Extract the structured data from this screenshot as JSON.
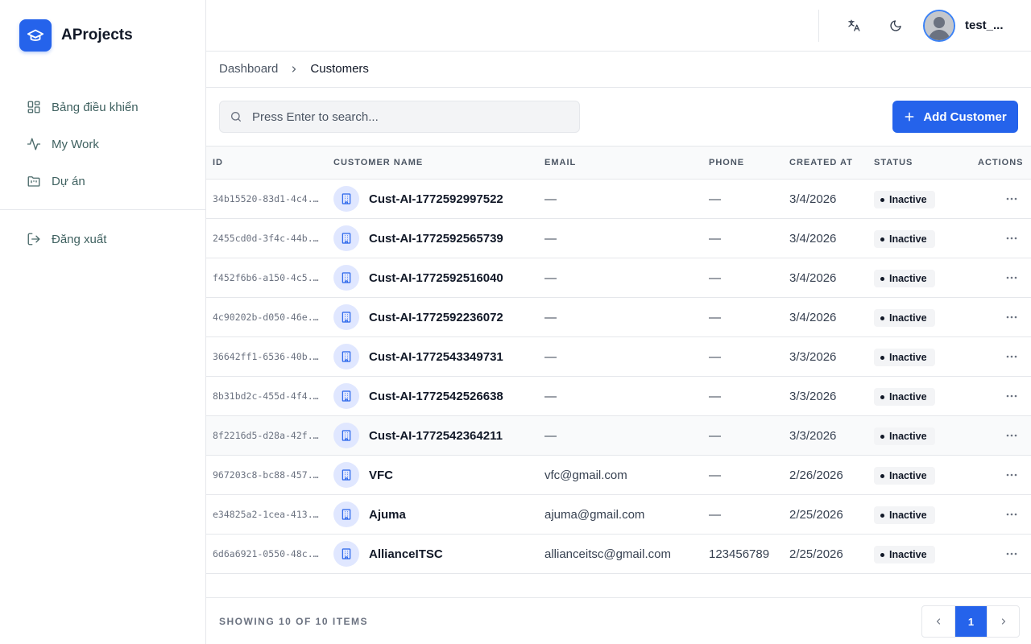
{
  "app": {
    "name": "AProjects"
  },
  "sidebar": {
    "items": [
      {
        "label": "Bảng điều khiển",
        "icon": "dashboard-grid-icon"
      },
      {
        "label": "My Work",
        "icon": "activity-icon"
      },
      {
        "label": "Dự án",
        "icon": "folder-kanban-icon"
      }
    ],
    "logout": {
      "label": "Đăng xuất",
      "icon": "logout-icon"
    }
  },
  "header": {
    "user": {
      "name": "test_..."
    },
    "icons": [
      "translate-icon",
      "moon-icon"
    ]
  },
  "breadcrumb": {
    "parent": "Dashboard",
    "current": "Customers"
  },
  "toolbar": {
    "search_placeholder": "Press Enter to search...",
    "add_label": "Add Customer"
  },
  "table": {
    "columns": {
      "id": "ID",
      "name": "Customer Name",
      "email": "Email",
      "phone": "Phone",
      "created": "Created At",
      "status": "Status",
      "actions": "Actions"
    },
    "rows": [
      {
        "id": "34b15520-83d1-4c4...",
        "name": "Cust-AI-1772592997522",
        "email": "—",
        "phone": "—",
        "created": "3/4/2026",
        "status": "Inactive"
      },
      {
        "id": "2455cd0d-3f4c-44b...",
        "name": "Cust-AI-1772592565739",
        "email": "—",
        "phone": "—",
        "created": "3/4/2026",
        "status": "Inactive"
      },
      {
        "id": "f452f6b6-a150-4c5...",
        "name": "Cust-AI-1772592516040",
        "email": "—",
        "phone": "—",
        "created": "3/4/2026",
        "status": "Inactive"
      },
      {
        "id": "4c90202b-d050-46e...",
        "name": "Cust-AI-1772592236072",
        "email": "—",
        "phone": "—",
        "created": "3/4/2026",
        "status": "Inactive"
      },
      {
        "id": "36642ff1-6536-40b...",
        "name": "Cust-AI-1772543349731",
        "email": "—",
        "phone": "—",
        "created": "3/3/2026",
        "status": "Inactive"
      },
      {
        "id": "8b31bd2c-455d-4f4...",
        "name": "Cust-AI-1772542526638",
        "email": "—",
        "phone": "—",
        "created": "3/3/2026",
        "status": "Inactive"
      },
      {
        "id": "8f2216d5-d28a-42f...",
        "name": "Cust-AI-1772542364211",
        "email": "—",
        "phone": "—",
        "created": "3/3/2026",
        "status": "Inactive"
      },
      {
        "id": "967203c8-bc88-457...",
        "name": "VFC",
        "email": "vfc@gmail.com",
        "phone": "—",
        "created": "2/26/2026",
        "status": "Inactive"
      },
      {
        "id": "e34825a2-1cea-413...",
        "name": "Ajuma",
        "email": "ajuma@gmail.com",
        "phone": "—",
        "created": "2/25/2026",
        "status": "Inactive"
      },
      {
        "id": "6d6a6921-0550-48c...",
        "name": "AllianceITSC",
        "email": "allianceitsc@gmail.com",
        "phone": "123456789",
        "created": "2/25/2026",
        "status": "Inactive"
      }
    ]
  },
  "footer": {
    "showing": "Showing 10 of 10 items",
    "current_page": "1"
  },
  "colors": {
    "accent": "#2563eb",
    "border": "#e5e7eb",
    "muted_text": "#6b7280"
  }
}
